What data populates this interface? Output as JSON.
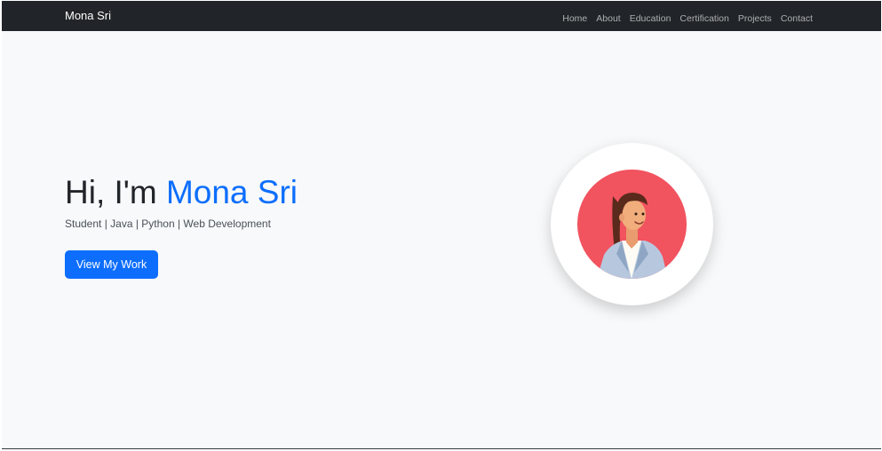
{
  "navbar": {
    "brand": "Mona Sri",
    "links": [
      {
        "label": "Home"
      },
      {
        "label": "About"
      },
      {
        "label": "Education"
      },
      {
        "label": "Certification"
      },
      {
        "label": "Projects"
      },
      {
        "label": "Contact"
      }
    ]
  },
  "hero": {
    "greeting": "Hi, I'm ",
    "name": "Mona Sri",
    "subtitle": "Student | Java | Python | Web Development",
    "cta_label": "View My Work",
    "avatar_icon": "woman-avatar-illustration"
  },
  "colors": {
    "navbar_bg": "#212529",
    "page_bg": "#f8f9fa",
    "accent": "#0d6efd",
    "avatar_bg": "#f1535f"
  }
}
